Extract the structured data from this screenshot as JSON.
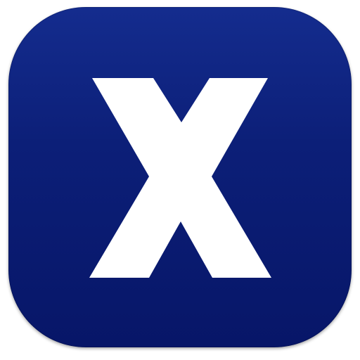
{
  "icon": {
    "name": "x-app-icon",
    "glyph": "X",
    "background_top": "#142c8e",
    "background_bottom": "#071668",
    "glyph_color": "#ffffff"
  }
}
